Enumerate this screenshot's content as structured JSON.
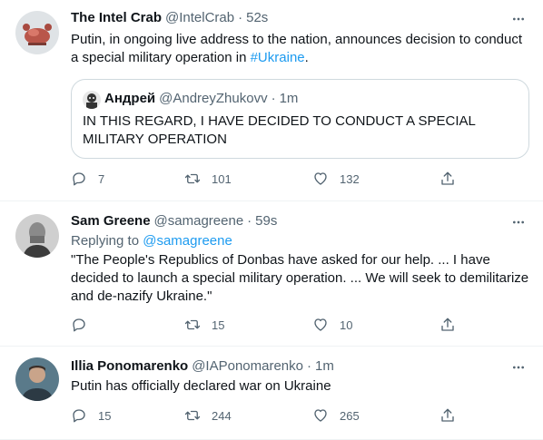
{
  "tweets": [
    {
      "name": "The Intel Crab",
      "handle": "@IntelCrab",
      "time": "52s",
      "text_before": "Putin, in ongoing live address to the nation, announces decision to conduct a special military operation in ",
      "hashtag": "#Ukraine",
      "text_after": ".",
      "quote": {
        "name": "Андрей",
        "handle": "@AndreyZhukovv",
        "time": "1m",
        "text": "IN THIS REGARD, I HAVE DECIDED TO CONDUCT A SPECIAL MILITARY OPERATION"
      },
      "replies": "7",
      "retweets": "101",
      "likes": "132"
    },
    {
      "name": "Sam Greene",
      "handle": "@samagreene",
      "time": "59s",
      "replying_prefix": "Replying to ",
      "replying_to": "@samagreene",
      "text": "\"The People's Republics of Donbas have asked for our help. ... I have decided to launch a special military operation. ... We will seek to demilitarize and de-nazify Ukraine.\"",
      "replies": "",
      "retweets": "15",
      "likes": "10"
    },
    {
      "name": "Illia Ponomarenko",
      "handle": "@IAPonomarenko",
      "time": "1m",
      "text": "Putin has officially declared war on Ukraine",
      "replies": "15",
      "retweets": "244",
      "likes": "265"
    }
  ],
  "dot_separator": "·",
  "icons": {
    "reply": "reply-icon",
    "retweet": "retweet-icon",
    "like": "heart-icon",
    "share": "share-icon",
    "more": "more-icon"
  },
  "colors": {
    "link": "#1d9bf0",
    "secondary_text": "#536471",
    "primary_text": "#0f1419",
    "border": "#eff3f4"
  }
}
